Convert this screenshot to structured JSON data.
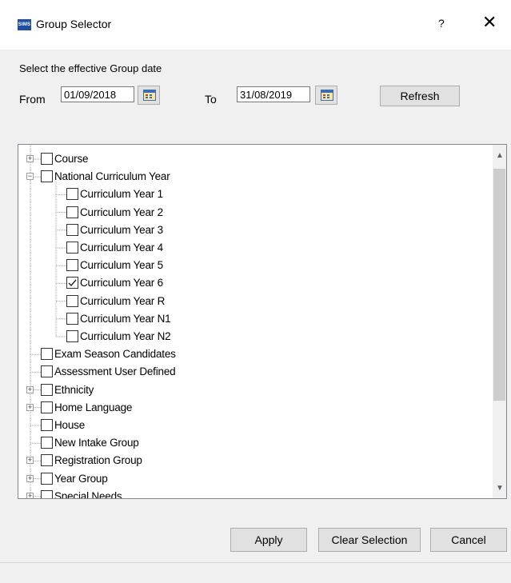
{
  "window": {
    "title": "Group Selector",
    "logo_text": "SIMS",
    "help_label": "?",
    "close_label": "✕"
  },
  "dates": {
    "caption": "Select the effective Group date",
    "from_label": "From",
    "from_value": "01/09/2018",
    "to_label": "To",
    "to_value": "31/08/2019",
    "refresh_label": "Refresh"
  },
  "tree": [
    {
      "label": "Course",
      "level": 0,
      "expander": "+",
      "checked": false
    },
    {
      "label": "National Curriculum Year",
      "level": 0,
      "expander": "−",
      "checked": false
    },
    {
      "label": "Curriculum Year  1",
      "level": 1,
      "expander": "",
      "checked": false
    },
    {
      "label": "Curriculum Year  2",
      "level": 1,
      "expander": "",
      "checked": false
    },
    {
      "label": "Curriculum Year  3",
      "level": 1,
      "expander": "",
      "checked": false
    },
    {
      "label": "Curriculum Year  4",
      "level": 1,
      "expander": "",
      "checked": false
    },
    {
      "label": "Curriculum Year  5",
      "level": 1,
      "expander": "",
      "checked": false
    },
    {
      "label": "Curriculum Year  6",
      "level": 1,
      "expander": "",
      "checked": true
    },
    {
      "label": "Curriculum Year  R",
      "level": 1,
      "expander": "",
      "checked": false
    },
    {
      "label": "Curriculum Year N1",
      "level": 1,
      "expander": "",
      "checked": false
    },
    {
      "label": "Curriculum Year N2",
      "level": 1,
      "expander": "",
      "checked": false
    },
    {
      "label": "Exam Season Candidates",
      "level": 0,
      "expander": "",
      "checked": false
    },
    {
      "label": "Assessment User Defined",
      "level": 0,
      "expander": "",
      "checked": false
    },
    {
      "label": "Ethnicity",
      "level": 0,
      "expander": "+",
      "checked": false
    },
    {
      "label": "Home Language",
      "level": 0,
      "expander": "+",
      "checked": false
    },
    {
      "label": "House",
      "level": 0,
      "expander": "",
      "checked": false
    },
    {
      "label": "New Intake Group",
      "level": 0,
      "expander": "",
      "checked": false
    },
    {
      "label": "Registration Group",
      "level": 0,
      "expander": "+",
      "checked": false
    },
    {
      "label": "Year Group",
      "level": 0,
      "expander": "+",
      "checked": false
    },
    {
      "label": "Special Needs",
      "level": 0,
      "expander": "+",
      "checked": false
    }
  ],
  "footer": {
    "apply_label": "Apply",
    "clear_label": "Clear Selection",
    "cancel_label": "Cancel"
  },
  "colors": {
    "accent": "#1f4f9e",
    "button_bg": "#e1e1e1",
    "border": "#adadad"
  },
  "icons": [
    "sims-logo-icon",
    "help-icon",
    "close-icon",
    "calendar-icon",
    "expand-icon",
    "collapse-icon",
    "checkmark-icon",
    "scroll-up-icon",
    "scroll-down-icon"
  ]
}
